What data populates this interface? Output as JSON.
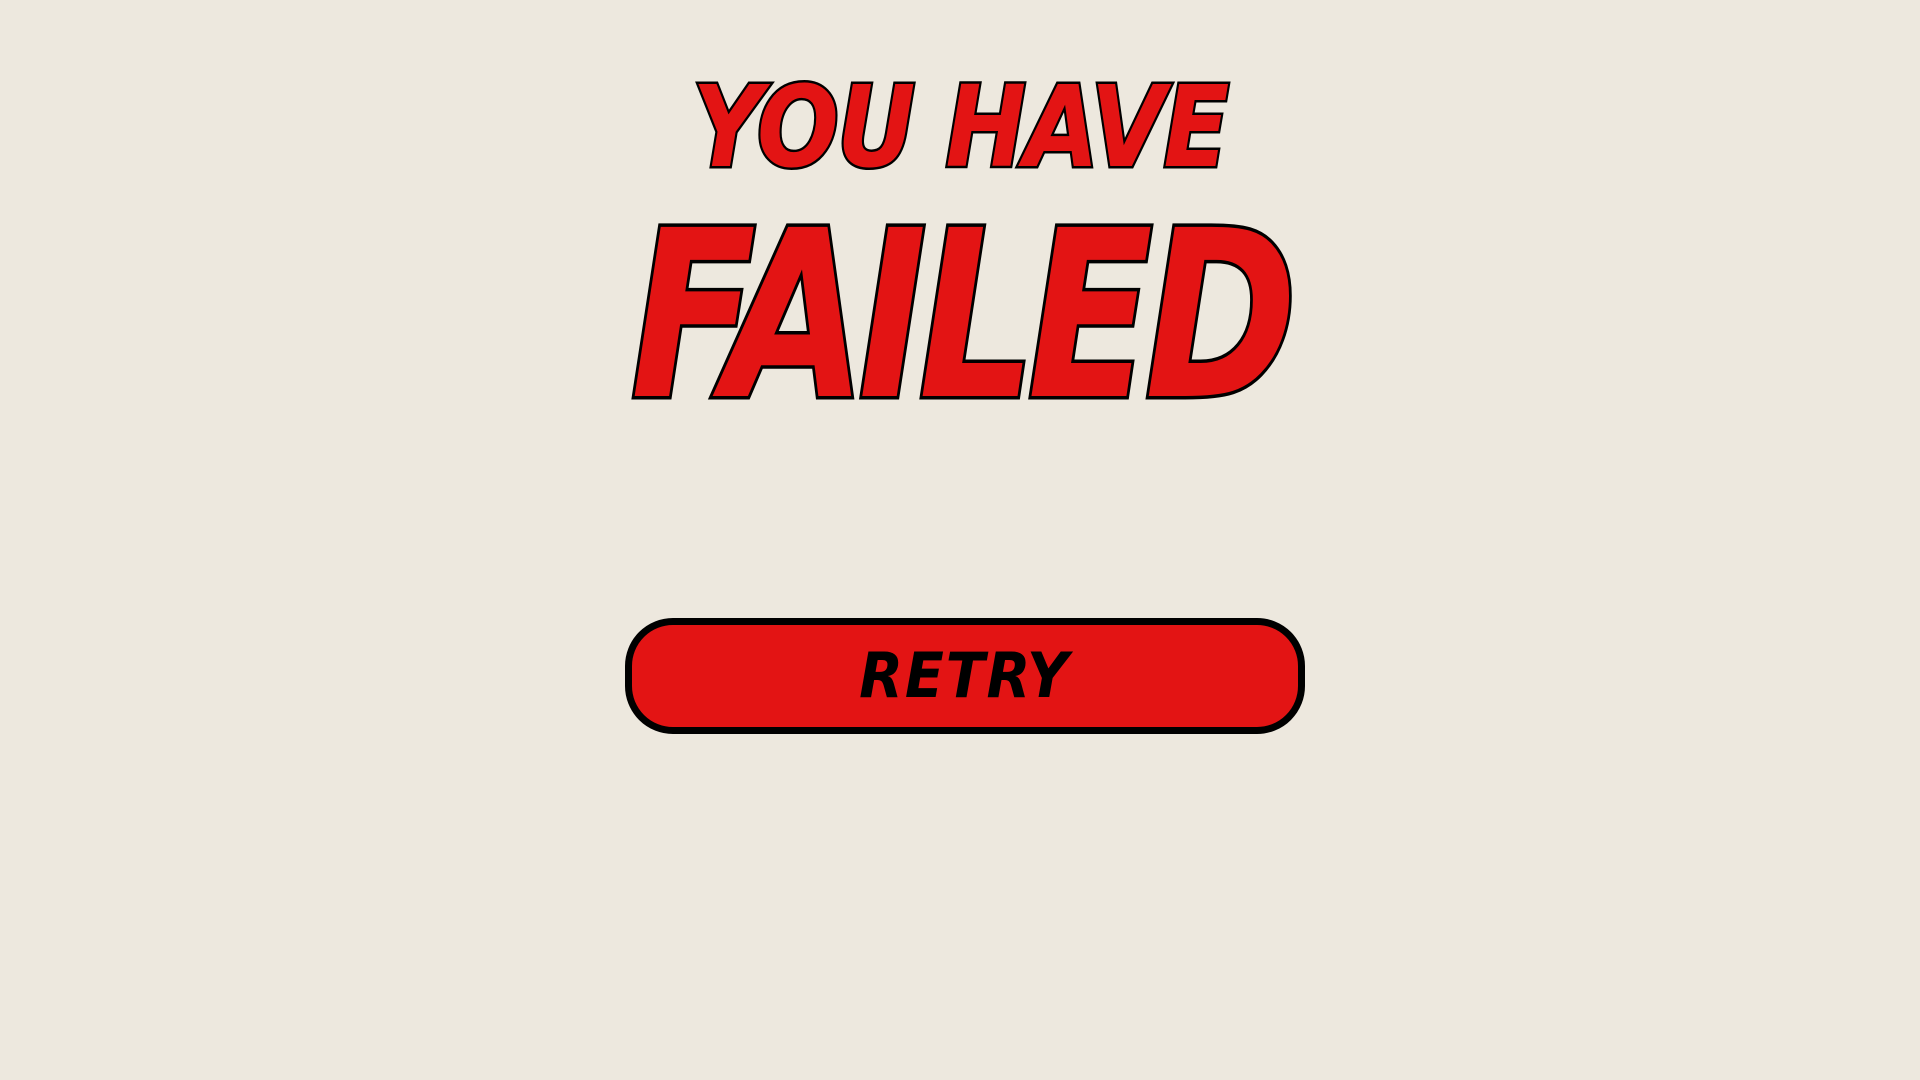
{
  "screen": {
    "heading_sub": "YOU HAVE",
    "heading_main": "FAILED",
    "retry_label": "RETRY"
  },
  "colors": {
    "background": "#ede8de",
    "accent": "#e31414",
    "outline": "#000000"
  }
}
